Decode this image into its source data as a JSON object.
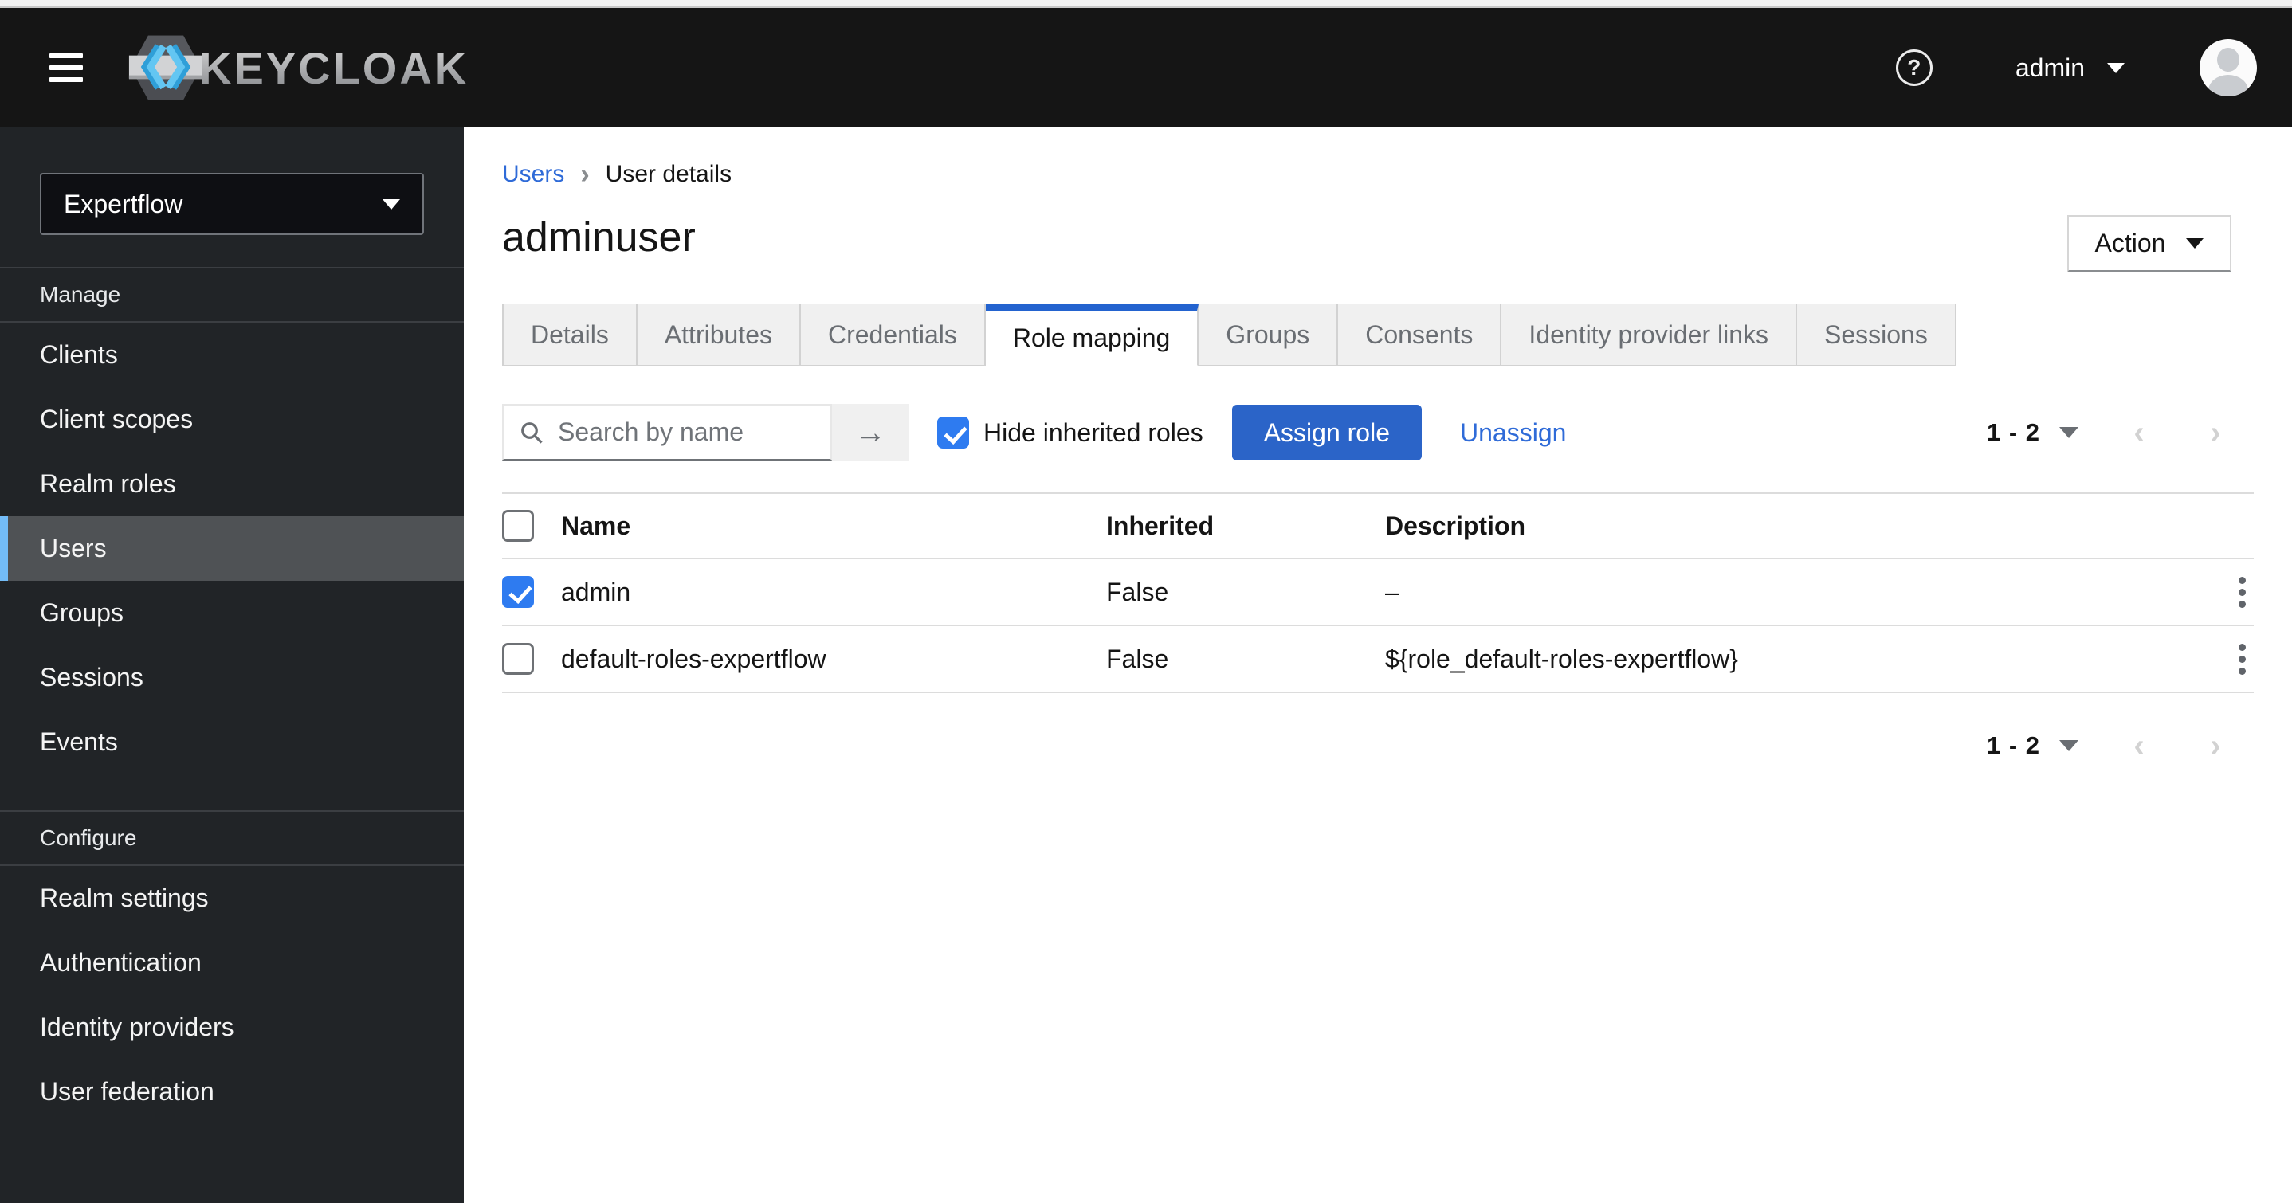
{
  "icons": {
    "help": "?",
    "arrow_right": "→",
    "breadcrumb_separator": "›",
    "chevron_left": "‹",
    "chevron_right": "›"
  },
  "colors": {
    "masthead_bg": "#151515",
    "sidebar_bg": "#212427",
    "selected_nav_bg": "#4f5255",
    "selected_nav_accent": "#73bcf7",
    "link_blue": "#2f6bd8",
    "primary_button_blue": "#2b64c8",
    "checkbox_blue": "#2e7bf0",
    "active_tab_bar": "#2363cf"
  },
  "topbar": {
    "brand": "KEYCLOAK",
    "user_name": "admin"
  },
  "sidebar": {
    "realm_selector": {
      "value": "Expertflow"
    },
    "groups": [
      {
        "title": "Manage",
        "items": [
          {
            "label": "Clients",
            "selected": false
          },
          {
            "label": "Client scopes",
            "selected": false
          },
          {
            "label": "Realm roles",
            "selected": false
          },
          {
            "label": "Users",
            "selected": true
          },
          {
            "label": "Groups",
            "selected": false
          },
          {
            "label": "Sessions",
            "selected": false
          },
          {
            "label": "Events",
            "selected": false
          }
        ]
      },
      {
        "title": "Configure",
        "items": [
          {
            "label": "Realm settings",
            "selected": false
          },
          {
            "label": "Authentication",
            "selected": false
          },
          {
            "label": "Identity providers",
            "selected": false
          },
          {
            "label": "User federation",
            "selected": false
          }
        ]
      }
    ]
  },
  "breadcrumb": {
    "items": [
      {
        "label": "Users",
        "link": true
      },
      {
        "label": "User details",
        "link": false
      }
    ]
  },
  "page": {
    "title": "adminuser",
    "action_button": "Action"
  },
  "tabs": [
    {
      "label": "Details",
      "active": false
    },
    {
      "label": "Attributes",
      "active": false
    },
    {
      "label": "Credentials",
      "active": false
    },
    {
      "label": "Role mapping",
      "active": true
    },
    {
      "label": "Groups",
      "active": false
    },
    {
      "label": "Consents",
      "active": false
    },
    {
      "label": "Identity provider links",
      "active": false
    },
    {
      "label": "Sessions",
      "active": false
    }
  ],
  "toolbar": {
    "search_placeholder": "Search by name",
    "search_value": "",
    "hide_inherited_label": "Hide inherited roles",
    "hide_inherited_checked": true,
    "assign_button": "Assign role",
    "unassign_link": "Unassign"
  },
  "pagination": {
    "range": "1 - 2"
  },
  "table": {
    "columns": [
      "Name",
      "Inherited",
      "Description"
    ],
    "rows": [
      {
        "checked": true,
        "name": "admin",
        "inherited": "False",
        "description": "–"
      },
      {
        "checked": false,
        "name": "default-roles-expertflow",
        "inherited": "False",
        "description": "${role_default-roles-expertflow}"
      }
    ]
  }
}
